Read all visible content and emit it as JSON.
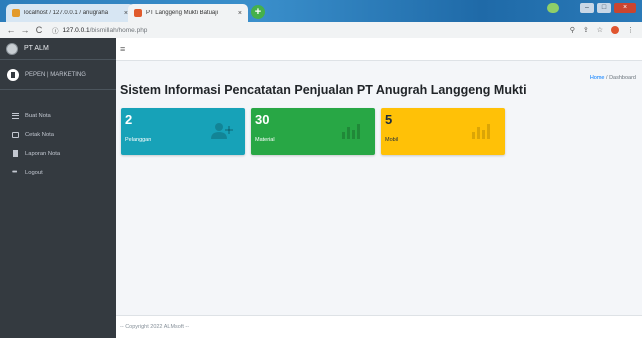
{
  "browser": {
    "tabs": [
      {
        "title": "localhost / 127.0.0.1 / anugraha",
        "close": "×"
      },
      {
        "title": "PT Langgeng Mukti Batuaji",
        "close": "×"
      }
    ],
    "new_tab": "+",
    "address": {
      "host": "127.0.0.1",
      "path": "/bismillah/home.php"
    },
    "nav": {
      "back": "←",
      "forward": "→",
      "reload": "C",
      "info": "ⓘ"
    },
    "right_icons": {
      "search": "⚲",
      "share": "⇪",
      "star": "☆",
      "menu": "⋮"
    },
    "window": {
      "minimize": "–",
      "maximize": "□",
      "close": "×"
    }
  },
  "sidebar": {
    "brand": "PT ALM",
    "user": "PEPEN | MARKETING",
    "items": [
      {
        "label": "Buat Nota"
      },
      {
        "label": "Cetak Nota"
      },
      {
        "label": "Laporan Nota"
      },
      {
        "label": "Logout"
      }
    ]
  },
  "header": {
    "menu_toggle": "≡"
  },
  "breadcrumb": {
    "home": "Home",
    "sep": "/",
    "current": "Dashboard"
  },
  "page_title": "Sistem Informasi Pencatatan Penjualan PT Anugrah Langgeng Mukti",
  "stats": [
    {
      "value": "2",
      "label": "Pelanggan",
      "color": "#17a2b8",
      "icon": "user-plus-icon"
    },
    {
      "value": "30",
      "label": "Material",
      "color": "#28a745",
      "icon": "bar-chart-icon"
    },
    {
      "value": "5",
      "label": "Mobil",
      "color": "#ffc107",
      "icon": "bar-chart-icon"
    }
  ],
  "footer": "-- Copyright 2022 ALMsoft --"
}
